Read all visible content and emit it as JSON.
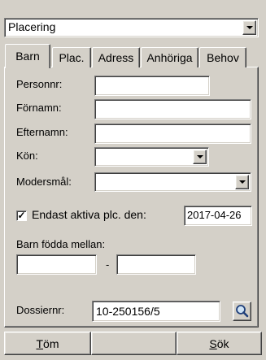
{
  "category_select": {
    "value": "Placering"
  },
  "tabs": [
    {
      "label": "Barn",
      "active": true
    },
    {
      "label": "Plac.",
      "active": false
    },
    {
      "label": "Adress",
      "active": false
    },
    {
      "label": "Anhöriga",
      "active": false
    },
    {
      "label": "Behov",
      "active": false
    }
  ],
  "form": {
    "personnr": {
      "label": "Personnr:",
      "value": ""
    },
    "fornamn": {
      "label": "Förnamn:",
      "value": ""
    },
    "efternamn": {
      "label": "Efternamn:",
      "value": ""
    },
    "kon": {
      "label": "Kön:",
      "value": ""
    },
    "modersmal": {
      "label": "Modersmål:",
      "value": ""
    },
    "active_only": {
      "label": "Endast aktiva plc. den:",
      "checked": true,
      "date": "2017-04-26"
    },
    "born_between": {
      "label": "Barn födda mellan:",
      "from": "",
      "separator": "-",
      "to": ""
    },
    "dossiernr": {
      "label": "Dossiernr:",
      "value": "10-250156/5"
    }
  },
  "buttons": {
    "clear": {
      "label_underlined": "T",
      "label_rest": "öm"
    },
    "search": {
      "label_underlined": "S",
      "label_rest": "ök"
    }
  },
  "icons": {
    "search": "magnifier-icon",
    "dropdown": "chevron-down-icon",
    "check": "checkmark"
  }
}
